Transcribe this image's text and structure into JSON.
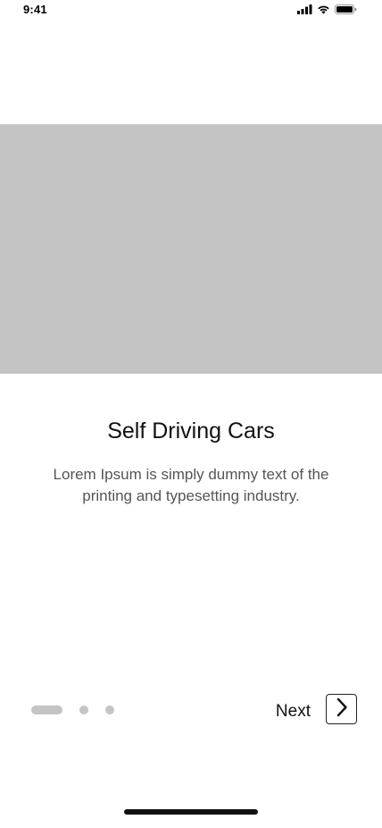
{
  "status_bar": {
    "time": "9:41",
    "icons": [
      "cellular-signal-icon",
      "wifi-icon",
      "battery-icon"
    ]
  },
  "hero": {
    "icon": "image-placeholder"
  },
  "content": {
    "title": "Self Driving Cars",
    "description": "Lorem Ipsum is simply dummy text of the printing and typesetting industry."
  },
  "pagination": {
    "total_pages": 3,
    "current_page": 1
  },
  "navigation": {
    "next_label": "Next",
    "next_icon": "chevron-right-icon"
  },
  "colors": {
    "placeholder": "#c4c4c4",
    "text_primary": "#111111",
    "text_secondary": "#555555",
    "dot_inactive": "#c4c4c4"
  }
}
